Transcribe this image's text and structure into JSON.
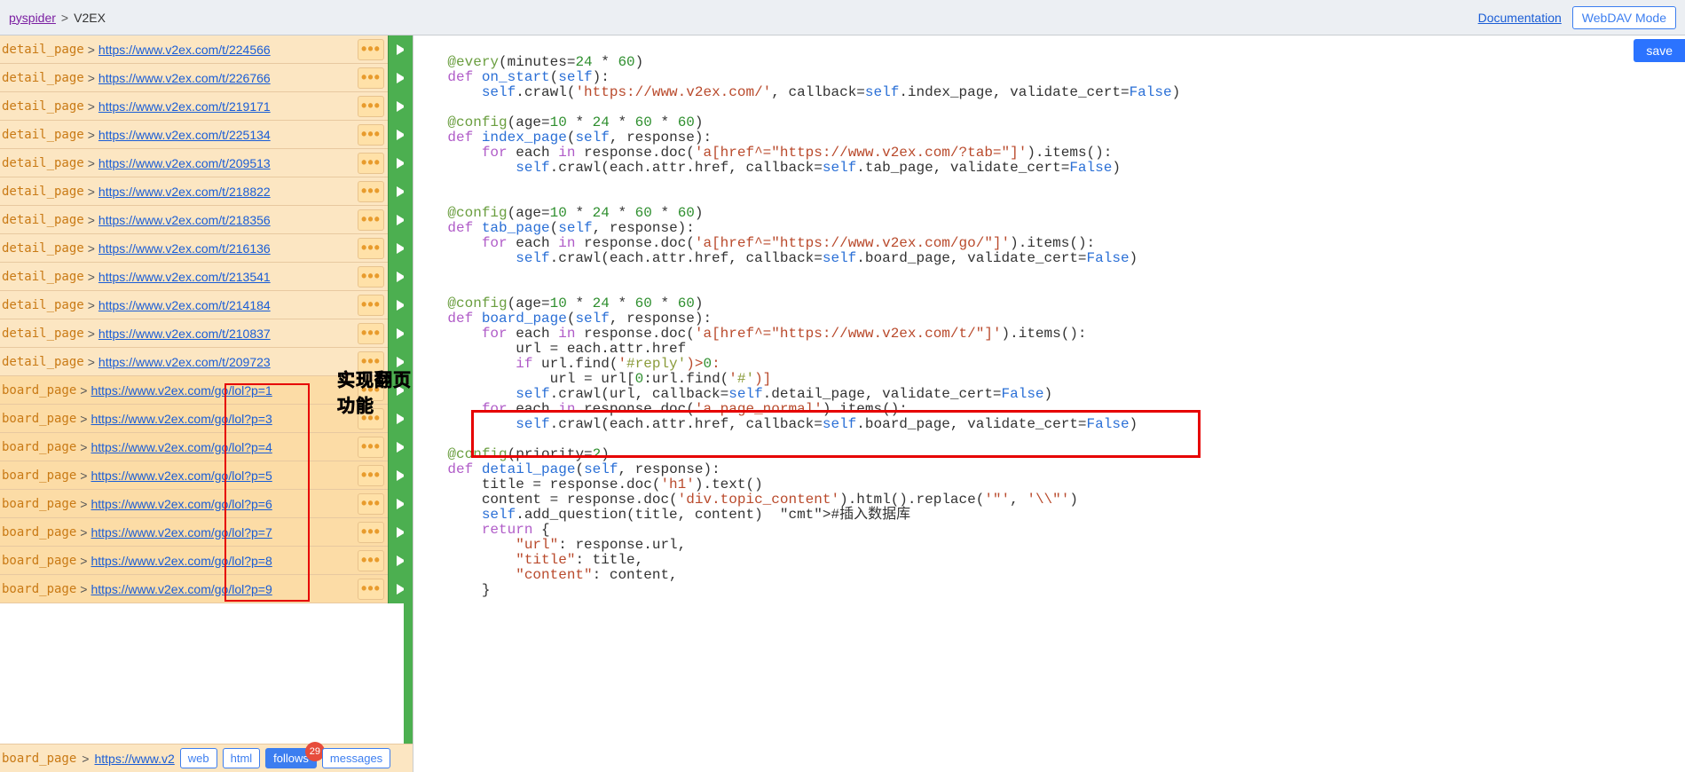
{
  "header": {
    "home": "pyspider",
    "sep": ">",
    "project": "V2EX",
    "doc": "Documentation",
    "webdav": "WebDAV Mode",
    "save": "save"
  },
  "annotation": "实现翻页功能",
  "toolbar": {
    "callback": "board_page",
    "trunc_url": "https://www.v2",
    "web": "web",
    "html": "html",
    "follows": "follows",
    "badge": "29",
    "messages": "messages"
  },
  "tasks": [
    {
      "cb": "detail_page",
      "url": "https://www.v2ex.com/t/224566",
      "kind": "detail"
    },
    {
      "cb": "detail_page",
      "url": "https://www.v2ex.com/t/226766",
      "kind": "detail"
    },
    {
      "cb": "detail_page",
      "url": "https://www.v2ex.com/t/219171",
      "kind": "detail"
    },
    {
      "cb": "detail_page",
      "url": "https://www.v2ex.com/t/225134",
      "kind": "detail"
    },
    {
      "cb": "detail_page",
      "url": "https://www.v2ex.com/t/209513",
      "kind": "detail"
    },
    {
      "cb": "detail_page",
      "url": "https://www.v2ex.com/t/218822",
      "kind": "detail"
    },
    {
      "cb": "detail_page",
      "url": "https://www.v2ex.com/t/218356",
      "kind": "detail"
    },
    {
      "cb": "detail_page",
      "url": "https://www.v2ex.com/t/216136",
      "kind": "detail"
    },
    {
      "cb": "detail_page",
      "url": "https://www.v2ex.com/t/213541",
      "kind": "detail"
    },
    {
      "cb": "detail_page",
      "url": "https://www.v2ex.com/t/214184",
      "kind": "detail"
    },
    {
      "cb": "detail_page",
      "url": "https://www.v2ex.com/t/210837",
      "kind": "detail"
    },
    {
      "cb": "detail_page",
      "url": "https://www.v2ex.com/t/209723",
      "kind": "detail"
    },
    {
      "cb": "board_page",
      "url": "https://www.v2ex.com/go/lol?p=1",
      "kind": "board"
    },
    {
      "cb": "board_page",
      "url": "https://www.v2ex.com/go/lol?p=3",
      "kind": "board"
    },
    {
      "cb": "board_page",
      "url": "https://www.v2ex.com/go/lol?p=4",
      "kind": "board"
    },
    {
      "cb": "board_page",
      "url": "https://www.v2ex.com/go/lol?p=5",
      "kind": "board"
    },
    {
      "cb": "board_page",
      "url": "https://www.v2ex.com/go/lol?p=6",
      "kind": "board"
    },
    {
      "cb": "board_page",
      "url": "https://www.v2ex.com/go/lol?p=7",
      "kind": "board"
    },
    {
      "cb": "board_page",
      "url": "https://www.v2ex.com/go/lol?p=8",
      "kind": "board"
    },
    {
      "cb": "board_page",
      "url": "https://www.v2ex.com/go/lol?p=9",
      "kind": "board"
    }
  ],
  "code": {
    "l1": "    @every(minutes=24 * 60)",
    "l2": "    def on_start(self):",
    "l3": "        self.crawl('https://www.v2ex.com/', callback=self.index_page, validate_cert=False)",
    "l4": "",
    "l5": "    @config(age=10 * 24 * 60 * 60)",
    "l6": "    def index_page(self, response):",
    "l7": "        for each in response.doc('a[href^=\"https://www.v2ex.com/?tab=\"]').items():",
    "l8": "            self.crawl(each.attr.href, callback=self.tab_page, validate_cert=False)",
    "l9": "",
    "l10": "",
    "l11": "    @config(age=10 * 24 * 60 * 60)",
    "l12": "    def tab_page(self, response):",
    "l13": "        for each in response.doc('a[href^=\"https://www.v2ex.com/go/\"]').items():",
    "l14": "            self.crawl(each.attr.href, callback=self.board_page, validate_cert=False)",
    "l15": "",
    "l16": "",
    "l17": "    @config(age=10 * 24 * 60 * 60)",
    "l18": "    def board_page(self, response):",
    "l19": "        for each in response.doc('a[href^=\"https://www.v2ex.com/t/\"]').items():",
    "l20": "            url = each.attr.href",
    "l21": "            if url.find('#reply')>0:",
    "l22": "                url = url[0:url.find('#')]",
    "l23": "            self.crawl(url, callback=self.detail_page, validate_cert=False)",
    "l24": "        for each in response.doc('a.page_normal').items():",
    "l25": "            self.crawl(each.attr.href, callback=self.board_page, validate_cert=False)",
    "l26": "",
    "l27": "    @config(priority=2)",
    "l28": "    def detail_page(self, response):",
    "l29": "        title = response.doc('h1').text()",
    "l30": "        content = response.doc('div.topic_content').html().replace('\"', '\\\\\"')",
    "l31": "        self.add_question(title, content)  #插入数据库",
    "l32": "        return {",
    "l33": "            \"url\": response.url,",
    "l34": "            \"title\": title,",
    "l35": "            \"content\": content,",
    "l36": "        }"
  }
}
